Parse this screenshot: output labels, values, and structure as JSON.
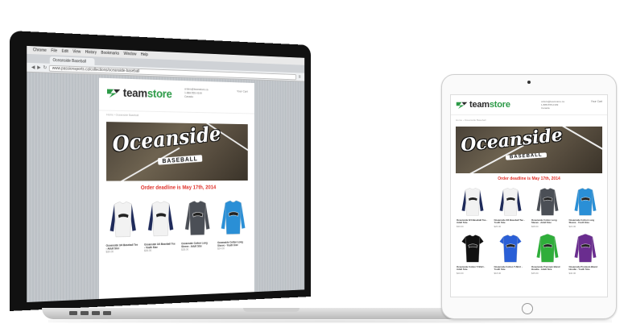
{
  "browser": {
    "menu": [
      "Chrome",
      "File",
      "Edit",
      "View",
      "History",
      "Bookmarks",
      "Window",
      "Help"
    ],
    "tab_label": "Oceanside Baseball",
    "url": "www.passionsports.ca/collections/oceanside-baseball"
  },
  "store": {
    "brand_prefix": "team",
    "brand_suffix": "store",
    "contact_line1": "orders@teamstore.ca",
    "contact_line2": "1-888-555-0199",
    "contact_line3": "Canada",
    "cart_label": "Your Cart",
    "breadcrumb_home": "Home",
    "breadcrumb_current": "Oceanside Baseball",
    "banner_title": "Oceanside",
    "banner_subtitle": "BASEBALL",
    "deadline": "Order deadline is May 17th, 2014"
  },
  "laptop_products": [
    {
      "name": "Oceanside 3/4 Baseball Tee - Adult Size",
      "price": "$30.00",
      "body": "#f2f2f2",
      "sleeve": "#1e2a5a"
    },
    {
      "name": "Oceanside 3/4 Baseball Tee - Youth Size",
      "price": "$26.00",
      "body": "#f2f2f2",
      "sleeve": "#1e2a5a"
    },
    {
      "name": "Oceanside Cotton Long Sleeve - Adult Size",
      "price": "$28.00",
      "body": "#4b4f56",
      "sleeve": "#4b4f56"
    },
    {
      "name": "Oceanside Cotton Long Sleeve - Youth Size",
      "price": "$24.00",
      "body": "#2a8fd6",
      "sleeve": "#2a8fd6"
    }
  ],
  "tablet_products": [
    {
      "name": "Oceanside 3/4 Baseball Tee - Adult Size",
      "price": "$30.00",
      "body": "#f2f2f2",
      "sleeve": "#1e2a5a",
      "kind": "long"
    },
    {
      "name": "Oceanside 3/4 Baseball Tee - Youth Size",
      "price": "$26.00",
      "body": "#f2f2f2",
      "sleeve": "#1e2a5a",
      "kind": "long"
    },
    {
      "name": "Oceanside Cotton Long Sleeve - Adult Size",
      "price": "$28.00",
      "body": "#4b4f56",
      "sleeve": "#4b4f56",
      "kind": "long"
    },
    {
      "name": "Oceanside Cotton Long Sleeve - Youth Size",
      "price": "$24.00",
      "body": "#2a8fd6",
      "sleeve": "#2a8fd6",
      "kind": "long"
    },
    {
      "name": "Oceanside Cotton T-Shirt - Adult Size",
      "price": "$20.00",
      "body": "#111111",
      "sleeve": "#111111",
      "kind": "tee"
    },
    {
      "name": "Oceanside Cotton T-Shirt - Youth Size",
      "price": "$18.00",
      "body": "#2a5fd6",
      "sleeve": "#2a5fd6",
      "kind": "tee"
    },
    {
      "name": "Oceanside Premium Blend Hoodie - Adult Size",
      "price": "$45.00",
      "body": "#2fae3a",
      "sleeve": "#2fae3a",
      "kind": "hoodie"
    },
    {
      "name": "Oceanside Premium Blend Hoodie - Youth Size",
      "price": "$40.00",
      "body": "#6a2d8f",
      "sleeve": "#6a2d8f",
      "kind": "hoodie"
    }
  ]
}
